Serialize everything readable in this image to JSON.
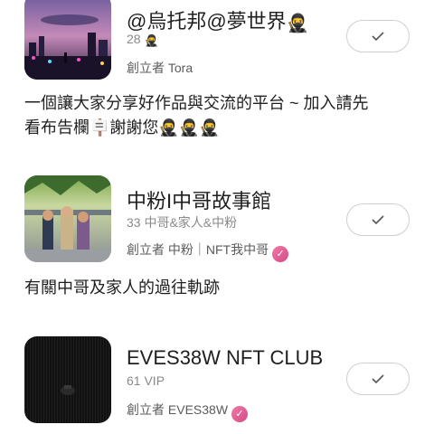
{
  "groups": [
    {
      "title": "@烏托邦@夢世界",
      "title_emoji": "🥷",
      "count": "28",
      "count_emoji": "🥷",
      "creator_prefix": "創立者",
      "creator_name": "Tora",
      "description_line1": "一個讓大家分享好作品與交流的平台 ~ 加入請先",
      "description_line2": "看布告欄🪧謝謝您🥷🥷🥷"
    },
    {
      "title": "中粉I中哥故事館",
      "count": "33 中哥&家人&中粉",
      "creator_prefix": "創立者",
      "creator_name": "中粉｜NFT我中哥",
      "verified": true,
      "description_line1": "有關中哥及家人的過往軌跡"
    },
    {
      "title": "EVES38W NFT CLUB",
      "count": "61 VIP",
      "creator_prefix": "創立者",
      "creator_name": "EVES38W",
      "verified": true
    }
  ],
  "colors": {
    "badge": "#e05a96",
    "check": "#555555",
    "follow_border": "#cfcfcf"
  },
  "icons": {
    "follow": "check-icon",
    "verified": "verified-badge-icon"
  }
}
